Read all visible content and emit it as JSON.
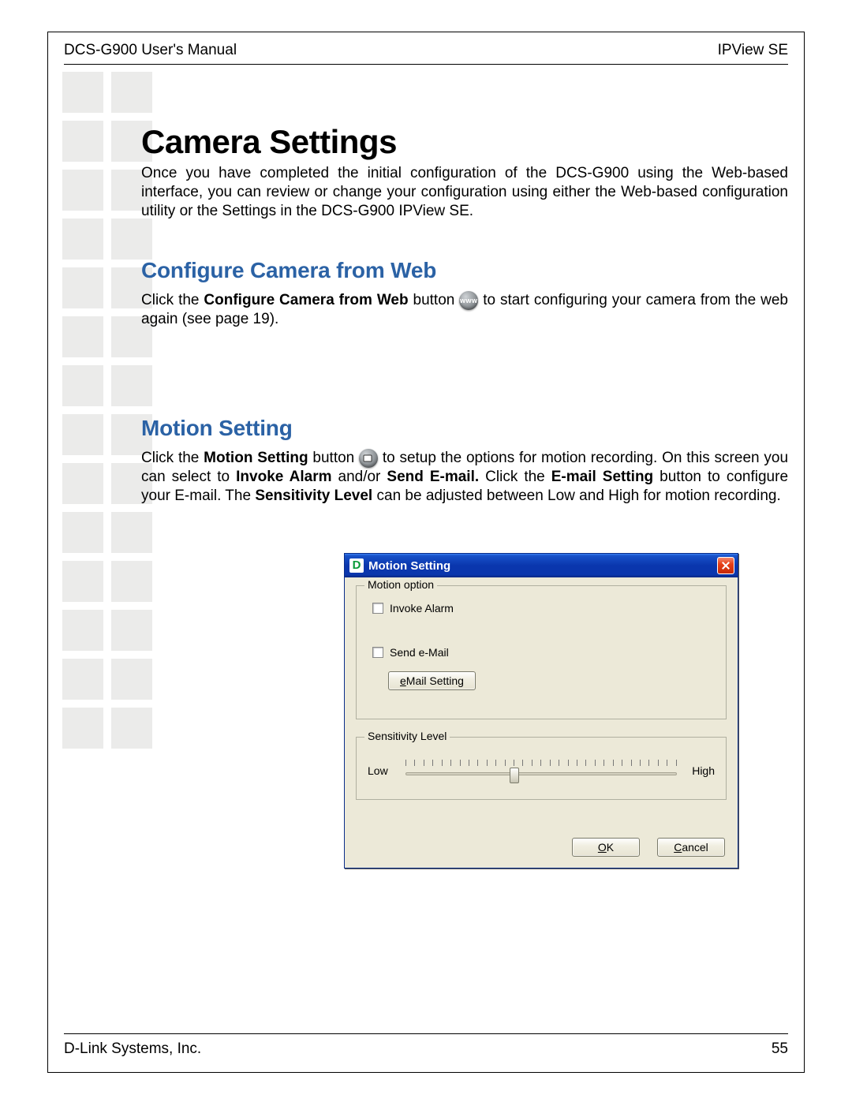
{
  "header": {
    "left": "DCS-G900 User's Manual",
    "right": "IPView SE"
  },
  "footer": {
    "left": "D-Link Systems, Inc.",
    "page": "55"
  },
  "h1": "Camera Settings",
  "intro": "Once you have completed the initial configuration of the DCS-G900 using the Web-based interface, you can review or change your configuration using either the Web-based configuration utility or the Settings in the DCS-G900 IPView SE.",
  "section1": {
    "heading": "Configure Camera from Web",
    "p_a": "Click the ",
    "p_bold": "Configure Camera from Web",
    "p_b": " button ",
    "icon_label": "www",
    "p_c": " to start configuring your camera from the web again (see page 19)."
  },
  "section2": {
    "heading": "Motion Setting",
    "p_a": "Click the ",
    "p_bold1": "Motion Setting",
    "p_b": " button ",
    "p_c": " to setup the options for motion recording. On this screen you can select to ",
    "p_bold2": "Invoke Alarm",
    "p_d": " and/or ",
    "p_bold3": "Send E-mail.",
    "p_e": " Click the ",
    "p_bold4": "E-mail Setting",
    "p_f": " button to configure your E-mail. The ",
    "p_bold5": "Sensitivity Level",
    "p_g": " can be adjusted between Low and High for motion recording."
  },
  "dialog": {
    "title": "Motion Setting",
    "icon_letter": "D",
    "group1": "Motion option",
    "chk1": "Invoke Alarm",
    "chk2": "Send e-Mail",
    "email_btn_pre": "e",
    "email_btn_rest": "Mail Setting",
    "group2": "Sensitivity Level",
    "low": "Low",
    "high": "High",
    "ok_u": "O",
    "ok_rest": "K",
    "cancel_u": "C",
    "cancel_rest": "ancel"
  }
}
